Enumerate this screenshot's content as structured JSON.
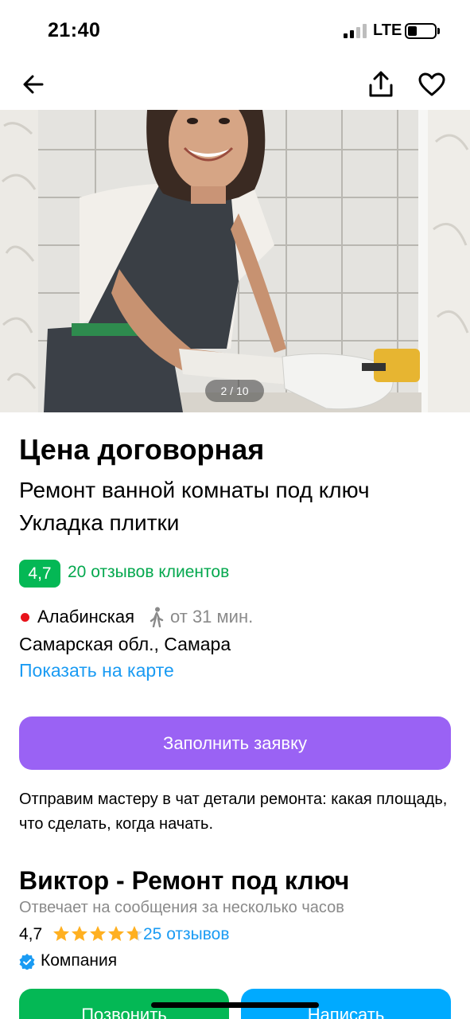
{
  "status_bar": {
    "time": "21:40",
    "network": "LTE",
    "battery_level": 0.35
  },
  "nav": {
    "back_icon": "arrow-left-icon",
    "share_icon": "share-icon",
    "favorite_icon": "heart-icon"
  },
  "gallery": {
    "counter": "2 / 10",
    "current_index": 2,
    "total": 10
  },
  "listing": {
    "price": "Цена договорная",
    "title_lines": [
      "Ремонт ванной комнаты под ключ",
      "Укладка плитки"
    ],
    "rating": "4,7",
    "reviews_link": "20 отзывов клиентов",
    "metro": "Алабинская",
    "metro_color": "#e8131b",
    "walk_time": "от 31 мин.",
    "address": "Самарская обл., Самара",
    "map_link": "Показать на карте"
  },
  "cta": {
    "button_label": "Заполнить заявку",
    "description": "Отправим мастеру в чат детали ремонта: какая площадь, что сделать, когда начать."
  },
  "seller": {
    "name": "Виктор - Ремонт под ключ",
    "reply_time": "Отвечает на сообщения за несколько часов",
    "rating": "4,7",
    "stars": 4.7,
    "reviews_link": "25 отзывов",
    "type": "Компания"
  },
  "actions": {
    "call_label": "Позвонить",
    "write_label": "Написать"
  },
  "colors": {
    "accent_green": "#04b855",
    "cta_purple": "#9a62f4",
    "link_blue": "#1a9bf3",
    "write_blue": "#00aaff",
    "star": "#ffb021"
  }
}
